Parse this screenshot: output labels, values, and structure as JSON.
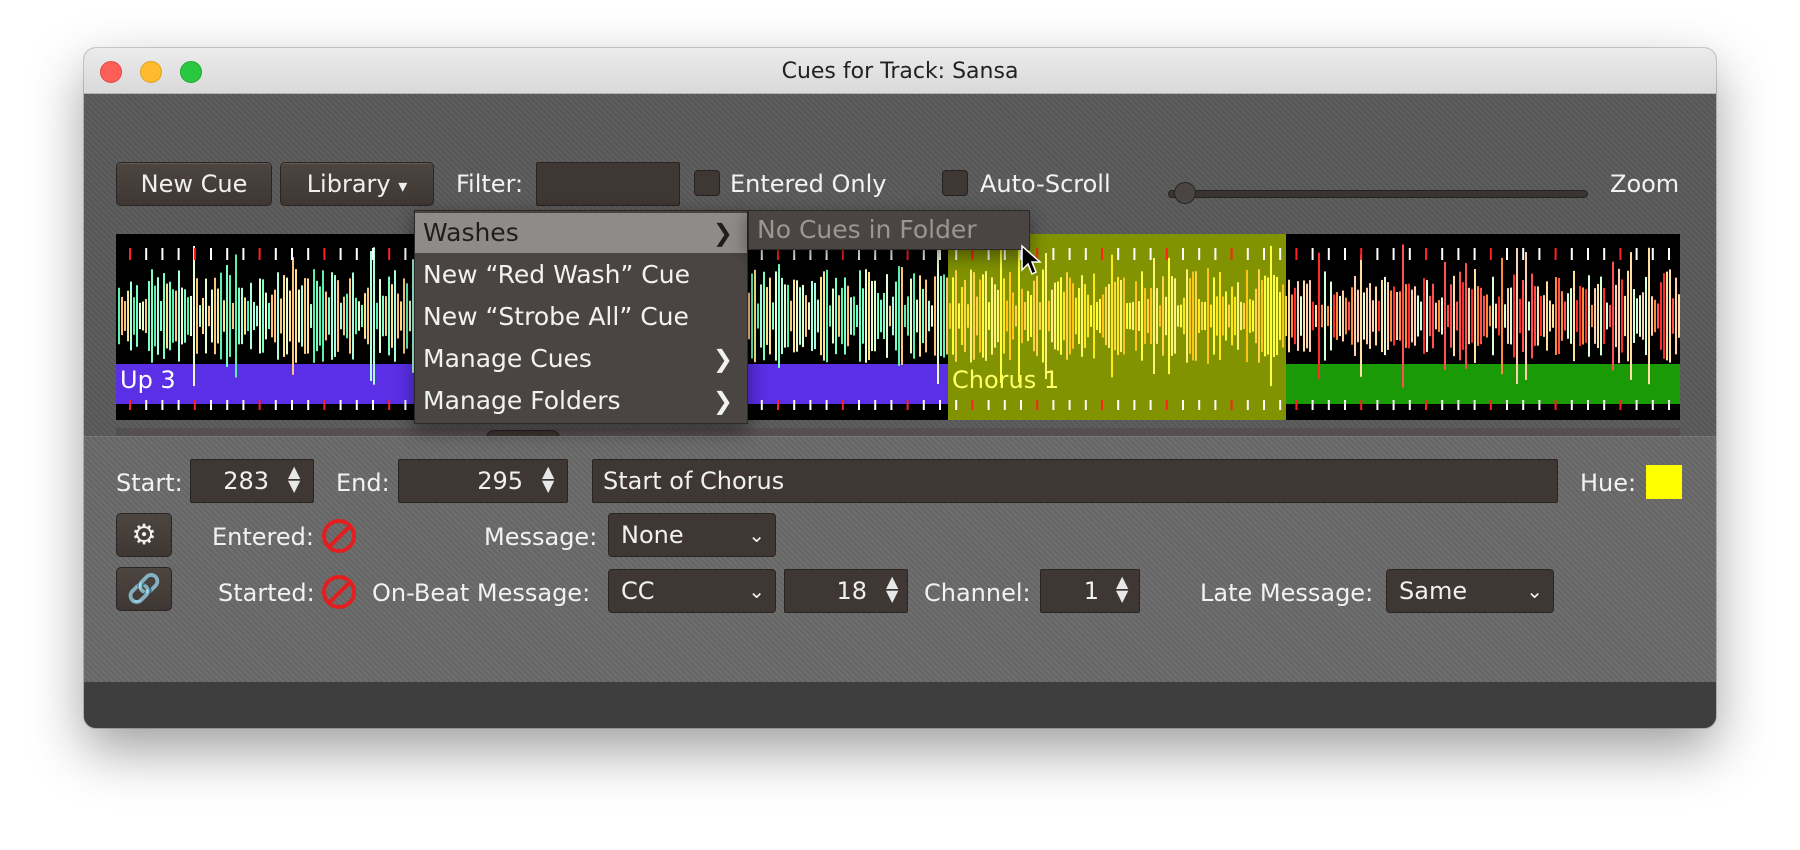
{
  "window": {
    "title": "Cues for Track: Sansa"
  },
  "toolbar": {
    "new_cue": "New Cue",
    "library": "Library",
    "library_arrow": "▾",
    "filter_label": "Filter:",
    "filter_value": "",
    "entered_only": "Entered Only",
    "auto_scroll": "Auto-Scroll",
    "zoom": "Zoom"
  },
  "library_menu": {
    "items": [
      {
        "label": "Washes",
        "submenu": true
      },
      {
        "label": "New “Red Wash” Cue",
        "submenu": false
      },
      {
        "label": "New “Strobe All” Cue",
        "submenu": false
      },
      {
        "label": "Manage Cues",
        "submenu": true
      },
      {
        "label": "Manage Folders",
        "submenu": true
      }
    ],
    "submenu_text": "No Cues in Folder"
  },
  "waveform": {
    "sections": [
      {
        "label": "Up 3",
        "color": "#5a2fe6"
      },
      {
        "label": "Chorus 1",
        "color": "#a5bd00"
      }
    ]
  },
  "editor": {
    "start_label": "Start:",
    "start_value": "283",
    "end_label": "End:",
    "end_value": "295",
    "comment": "Start of Chorus",
    "hue_label": "Hue:",
    "hue_color": "#ffff00",
    "entered_label": "Entered:",
    "message_label": "Message:",
    "message_value": "None",
    "started_label": "Started:",
    "onbeat_label": "On-Beat Message:",
    "onbeat_value": "CC",
    "onbeat_number": "18",
    "channel_label": "Channel:",
    "channel_value": "1",
    "late_label": "Late Message:",
    "late_value": "Same"
  },
  "icons": {
    "gear": "gear-icon",
    "link": "link-icon",
    "spinner_up": "▲",
    "spinner_down": "▼",
    "chevron": "⌄",
    "menu_arrow": "❯"
  }
}
